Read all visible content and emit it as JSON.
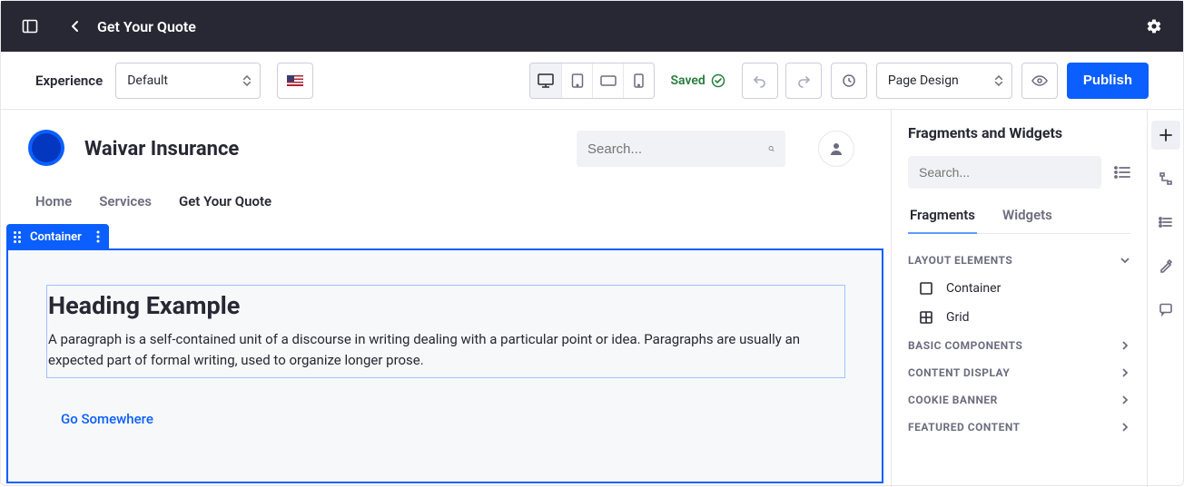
{
  "header": {
    "title": "Get Your Quote"
  },
  "toolbar": {
    "experience_label": "Experience",
    "experience_value": "Default",
    "saved_label": "Saved",
    "page_design_label": "Page Design",
    "publish_label": "Publish"
  },
  "site": {
    "title": "Waivar Insurance",
    "search_placeholder": "Search...",
    "nav": {
      "items": [
        "Home",
        "Services",
        "Get Your Quote"
      ],
      "active_index": 2
    }
  },
  "canvas": {
    "selected_label": "Container",
    "heading": "Heading Example",
    "paragraph": "A paragraph is a self-contained unit of a discourse in writing dealing with a particular point or idea. Paragraphs are usually an expected part of formal writing, used to organize longer prose.",
    "link_label": "Go Somewhere"
  },
  "panel": {
    "title": "Fragments and Widgets",
    "search_placeholder": "Search...",
    "tabs": [
      "Fragments",
      "Widgets"
    ],
    "active_tab": 0,
    "layout_elements_label": "LAYOUT ELEMENTS",
    "layout_items": [
      "Container",
      "Grid"
    ],
    "sections": [
      "BASIC COMPONENTS",
      "CONTENT DISPLAY",
      "COOKIE BANNER",
      "FEATURED CONTENT"
    ]
  }
}
